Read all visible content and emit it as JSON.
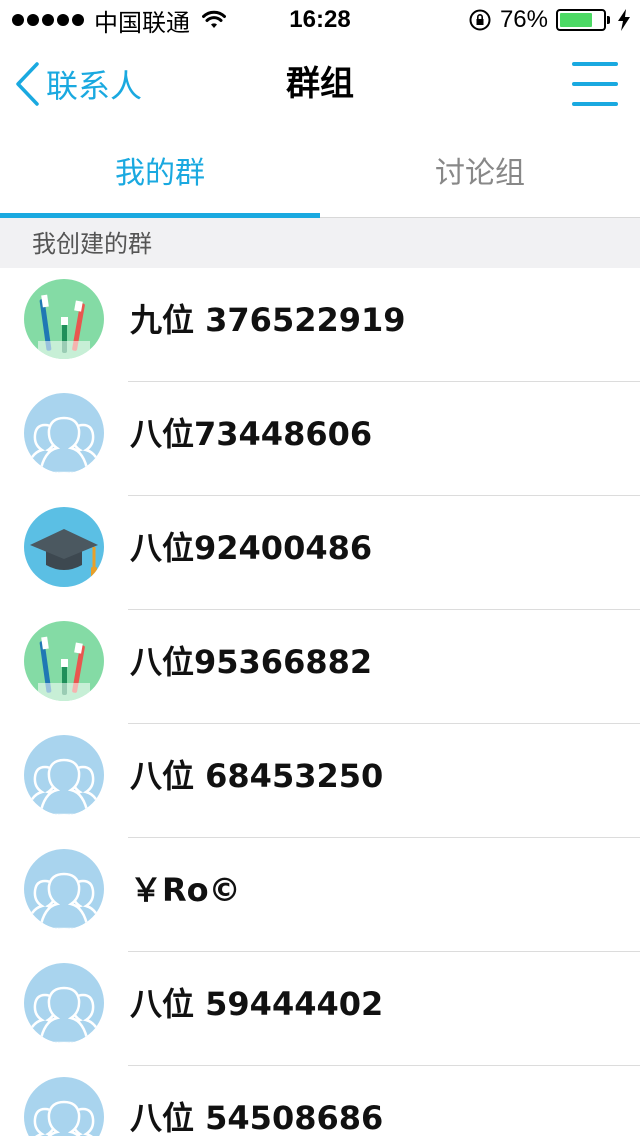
{
  "status_bar": {
    "carrier": "中国联通",
    "time": "16:28",
    "battery_percent": "76%",
    "battery_level": 0.76,
    "icons": [
      "signal-dots-icon",
      "wifi-icon",
      "rotation-lock-icon",
      "battery-icon",
      "charging-bolt-icon"
    ]
  },
  "nav": {
    "back_label": "联系人",
    "title": "群组",
    "back_icon": "chevron-left-icon",
    "menu_icon": "menu-icon"
  },
  "tabs": [
    {
      "label": "我的群",
      "active": true
    },
    {
      "label": "讨论组",
      "active": false
    }
  ],
  "section": {
    "title": "我创建的群"
  },
  "groups": [
    {
      "name": "九位 376522919",
      "avatar": "toothbrush"
    },
    {
      "name": "八位73448606",
      "avatar": "people"
    },
    {
      "name": "八位92400486",
      "avatar": "graduation-cap"
    },
    {
      "name": "八位95366882",
      "avatar": "toothbrush"
    },
    {
      "name": "八位 68453250",
      "avatar": "people"
    },
    {
      "name": "￥Ro©",
      "avatar": "people"
    },
    {
      "name": "八位 59444402",
      "avatar": "people"
    },
    {
      "name": "八位 54508686",
      "avatar": "people"
    }
  ],
  "colors": {
    "accent": "#1aa9e0",
    "battery": "#4cd964",
    "section_bg": "#f1f1f3"
  }
}
